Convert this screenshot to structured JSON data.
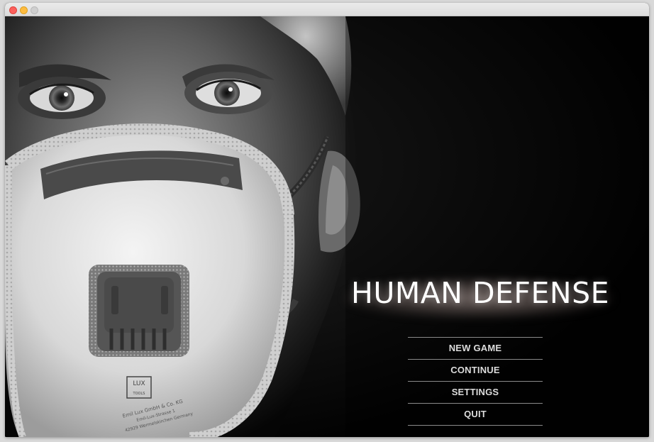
{
  "window": {
    "controls": [
      "close-icon",
      "minimize-icon",
      "maximize-icon"
    ]
  },
  "game": {
    "title": "HUMAN DEFENSE"
  },
  "menu": {
    "items": [
      {
        "label": "NEW GAME"
      },
      {
        "label": "CONTINUE"
      },
      {
        "label": "SETTINGS"
      },
      {
        "label": "QUIT"
      }
    ]
  },
  "mask_print": {
    "brand_logo": "LUX TOOLS",
    "text_lines": [
      "Emil Lux GmbH & Co. KG",
      "Emil-Lux-Strasse 1",
      "42929 Wermelskirchen Germany"
    ]
  },
  "colors": {
    "background": "#000000",
    "title_text": "#ffffff",
    "menu_text": "#dcdcdc",
    "menu_rule": "#8a8a8a"
  }
}
